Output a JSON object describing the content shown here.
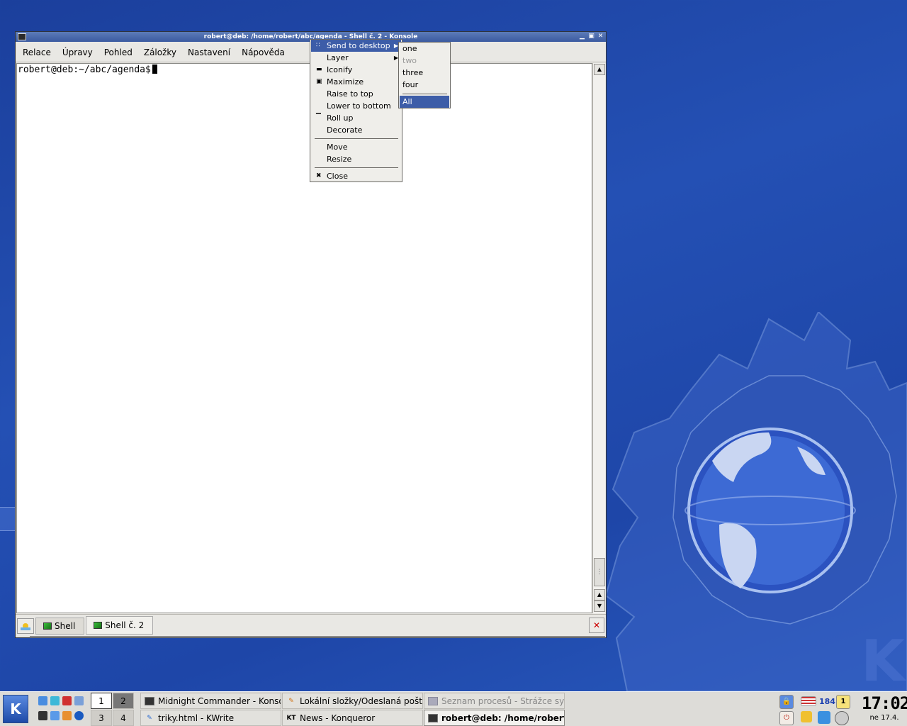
{
  "window": {
    "title": "robert@deb: /home/robert/abc/agenda - Shell č. 2 - Konsole",
    "buttons": [
      "minimize-icon",
      "maximize-icon",
      "close-icon"
    ],
    "menu": [
      "Relace",
      "Úpravy",
      "Pohled",
      "Záložky",
      "Nastavení",
      "Nápověda"
    ],
    "prompt": "robert@deb:~/abc/agenda$",
    "tabs": [
      {
        "label": "Shell",
        "active": false
      },
      {
        "label": "Shell č. 2",
        "active": true
      }
    ]
  },
  "context_menu": {
    "items": [
      {
        "label": "Send to desktop",
        "icon": "desktop-dots-icon",
        "submenu": true,
        "highlighted": true
      },
      {
        "label": "Layer",
        "icon": "",
        "submenu": true
      },
      {
        "label": "Iconify",
        "icon": "iconify-icon"
      },
      {
        "label": "Maximize",
        "icon": "maximize-icon"
      },
      {
        "label": "Raise to top",
        "icon": ""
      },
      {
        "label": "Lower to bottom",
        "icon": ""
      },
      {
        "label": "Roll up",
        "icon": "rollup-icon"
      },
      {
        "label": "Decorate",
        "icon": ""
      },
      {
        "label": "Move",
        "icon": ""
      },
      {
        "label": "Resize",
        "icon": ""
      },
      {
        "label": "Close",
        "icon": "close-icon"
      }
    ]
  },
  "desktop_submenu": {
    "items": [
      {
        "label": "one",
        "disabled": false
      },
      {
        "label": "two",
        "disabled": true
      },
      {
        "label": "three",
        "disabled": false
      },
      {
        "label": "four",
        "disabled": false
      },
      {
        "label": "All desktops",
        "highlighted": true
      }
    ]
  },
  "panel": {
    "pager": [
      "1",
      "2",
      "3",
      "4"
    ],
    "active_desktop": "1",
    "tasks": [
      {
        "label": "Midnight Commander - Konsole",
        "icon": "terminal-icon",
        "state": "normal"
      },
      {
        "label": "Lokální složky/Odeslaná pošta - ",
        "icon": "kmail-icon",
        "state": "normal"
      },
      {
        "label": "Seznam procesů - Strážce sy",
        "icon": "ksysguard-icon",
        "state": "dim"
      },
      {
        "label": "triky.html - KWrite",
        "icon": "kwrite-icon",
        "state": "normal"
      },
      {
        "label": "News - Konqueror",
        "icon": "konqueror-icon",
        "state": "normal",
        "icon_text": "KT"
      },
      {
        "label": "robert@deb: /home/robert/",
        "icon": "terminal-icon",
        "state": "active"
      }
    ],
    "tray": {
      "count": "184",
      "badge": "1"
    },
    "clock": {
      "time": "17:02",
      "date": "ne 17.4."
    }
  },
  "colors": {
    "highlight": "#3d5da8",
    "desktop": "#2450b4",
    "titlebar": "#4a68ab"
  }
}
